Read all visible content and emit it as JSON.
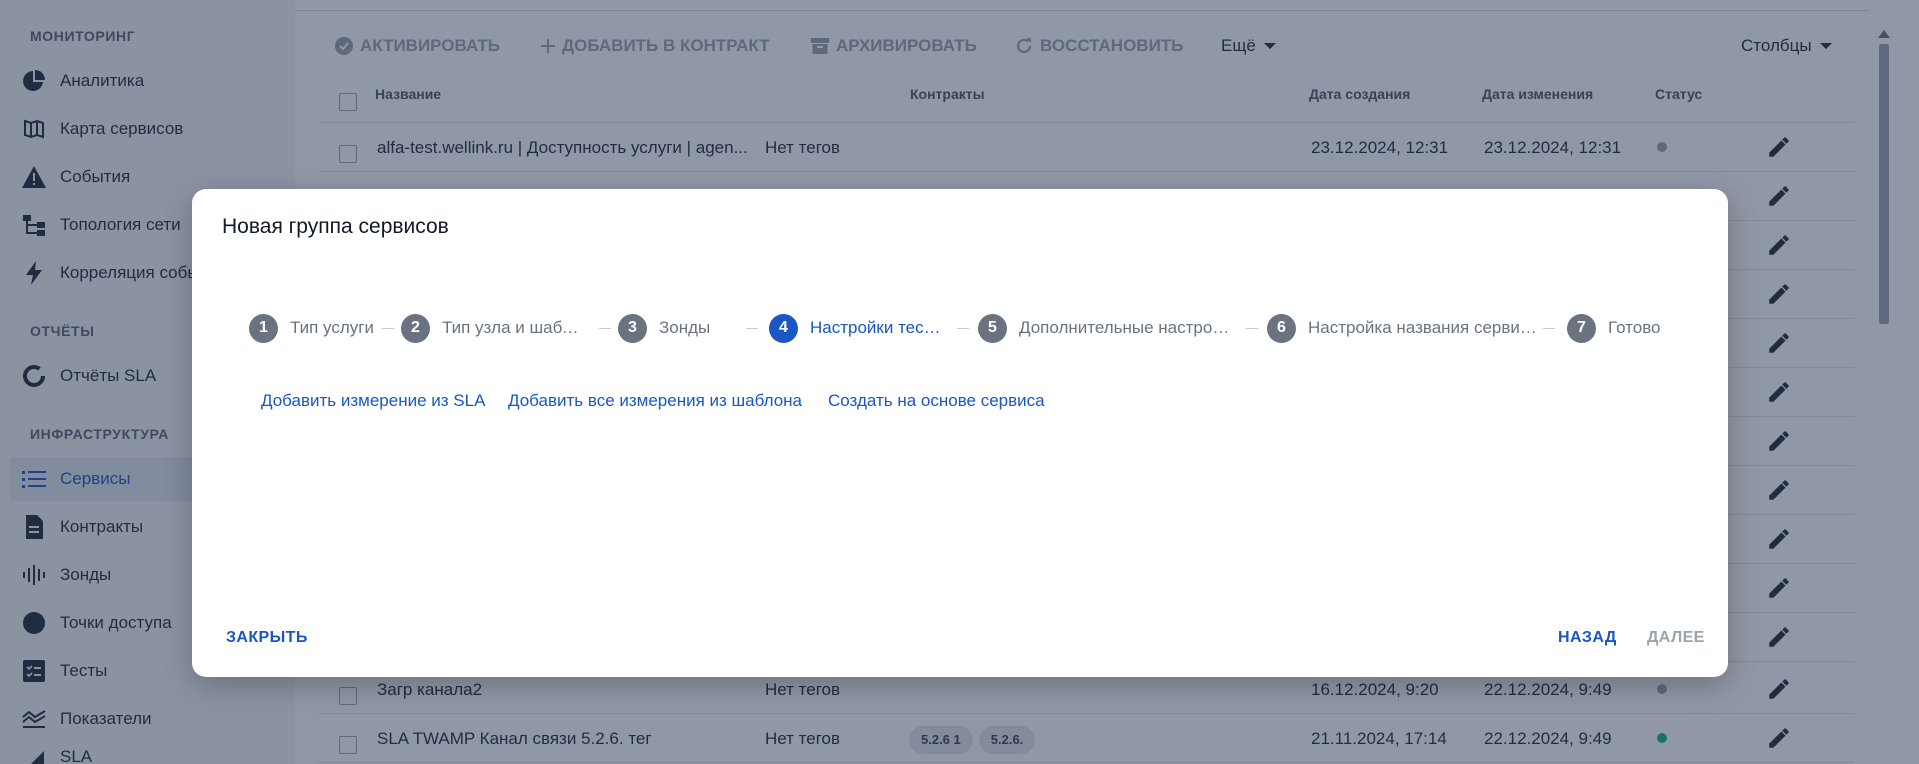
{
  "sidebar": {
    "sections": [
      {
        "title": "Мониторинг"
      },
      {
        "title": "Отчёты"
      },
      {
        "title": "Инфраструктура"
      }
    ],
    "items": [
      {
        "label": "Аналитика",
        "icon": "pie-chart-icon"
      },
      {
        "label": "Карта сервисов",
        "icon": "map-icon"
      },
      {
        "label": "События",
        "icon": "warning-icon"
      },
      {
        "label": "Топология сети",
        "icon": "topology-icon"
      },
      {
        "label": "Корреляция событий",
        "icon": "bolt-icon"
      },
      {
        "label": "Отчёты SLA",
        "icon": "donut-icon"
      },
      {
        "label": "Сервисы",
        "icon": "list-icon"
      },
      {
        "label": "Контракты",
        "icon": "document-icon"
      },
      {
        "label": "Зонды",
        "icon": "waveform-icon"
      },
      {
        "label": "Точки доступа",
        "icon": "circle-icon"
      },
      {
        "label": "Тесты",
        "icon": "checklist-icon"
      },
      {
        "label": "Показатели",
        "icon": "metrics-icon"
      },
      {
        "label": "SLA",
        "icon": "triangle-icon"
      }
    ]
  },
  "toolbar": {
    "activate": "Активировать",
    "add_to_contract": "Добавить в контракт",
    "archive": "Архивировать",
    "restore": "Восстановить",
    "more": "Ещё",
    "columns": "Столбцы"
  },
  "table": {
    "headers": {
      "name": "Название",
      "contracts": "Контракты",
      "created": "Дата создания",
      "modified": "Дата изменения",
      "status": "Статус"
    },
    "rows": [
      {
        "name": "alfa-test.wellink.ru | Доступность услуги | agen...",
        "tags": "Нет тегов",
        "contracts": [],
        "created": "23.12.2024, 12:31",
        "modified": "23.12.2024, 12:31",
        "status_color": "#9ca3af"
      },
      {
        "name": "Загр канала2",
        "tags": "Нет тегов",
        "contracts": [],
        "created": "16.12.2024, 9:20",
        "modified": "22.12.2024, 9:49",
        "status_color": "#9ca3af"
      },
      {
        "name": "SLA TWAMP Канал связи 5.2.6. тег",
        "tags": "Нет тегов",
        "contracts": [
          "5.2.6 1",
          "5.2.6."
        ],
        "created": "21.11.2024, 17:14",
        "modified": "22.12.2024, 9:49",
        "status_color": "#10b981"
      }
    ]
  },
  "dialog": {
    "title": "Новая группа сервисов",
    "steps": [
      {
        "num": "1",
        "label": "Тип услуги"
      },
      {
        "num": "2",
        "label": "Тип узла и шаблона"
      },
      {
        "num": "3",
        "label": "Зонды"
      },
      {
        "num": "4",
        "label": "Настройки тестов"
      },
      {
        "num": "5",
        "label": "Дополнительные настройки"
      },
      {
        "num": "6",
        "label": "Настройка названия сервиса"
      },
      {
        "num": "7",
        "label": "Готово"
      }
    ],
    "active_step": 4,
    "links": {
      "add_from_sla": "Добавить измерение из SLA",
      "add_all_from_template": "Добавить все измерения из шаблона",
      "create_from_service": "Создать на основе сервиса"
    },
    "buttons": {
      "close": "Закрыть",
      "back": "Назад",
      "next": "Далее"
    },
    "colors": {
      "accent": "#1a56c4",
      "disabled": "#9aa3ae"
    }
  }
}
